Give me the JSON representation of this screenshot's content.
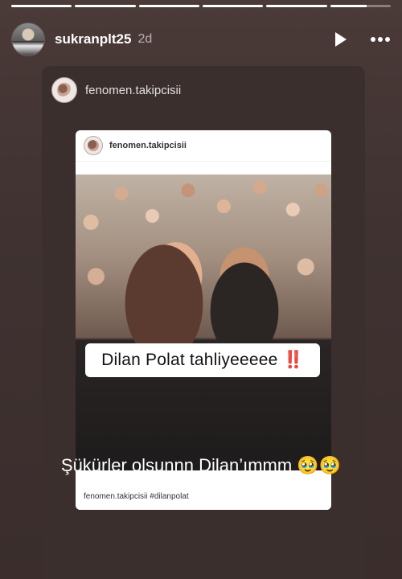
{
  "story": {
    "progress": [
      1,
      1,
      1,
      1,
      1,
      0.6
    ],
    "username": "sukranplt25",
    "time_ago": "2d",
    "icons": {
      "play": "play-icon",
      "more": "more-icon",
      "avatar": "avatar-icon"
    },
    "shared_post": {
      "username": "fenomen.takipcisii",
      "top_username": "fenomen.takipcisii",
      "caption_text": "Dilan Polat tahliyeeeee",
      "caption_emoji": "‼️",
      "footer_text": "fenomen.takipcisii #dilanpolat"
    },
    "story_text": "Şükürler olsunnn Dilan’ımmm 🥹🥹"
  }
}
